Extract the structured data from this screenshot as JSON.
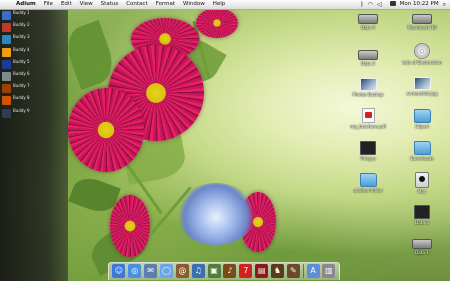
{
  "menubar": {
    "apple_glyph": "",
    "app_name": "Adium",
    "menus": [
      "File",
      "Edit",
      "View",
      "Status",
      "Contact",
      "Format",
      "Window",
      "Help"
    ],
    "clock": "Mon 10:22 PM"
  },
  "buddies": [
    {
      "name": "Buddy 1",
      "status": "",
      "avatar_color": "#3a6ccf"
    },
    {
      "name": "Buddy 2",
      "status": "",
      "avatar_color": "#c0392b"
    },
    {
      "name": "Buddy 3",
      "status": "",
      "avatar_color": "#2e86c1"
    },
    {
      "name": "Buddy 4",
      "status": "",
      "avatar_color": "#f39c12"
    },
    {
      "name": "Buddy 5",
      "status": "",
      "avatar_color": "#1f3a93"
    },
    {
      "name": "Buddy 6",
      "status": "",
      "avatar_color": "#7f8c8d"
    },
    {
      "name": "Buddy 7",
      "status": "",
      "avatar_color": "#a04000"
    },
    {
      "name": "Buddy 8",
      "status": "",
      "avatar_color": "#d35400"
    },
    {
      "name": "Buddy 9",
      "status": "",
      "avatar_color": "#2c3e50"
    }
  ],
  "desktop_icons": {
    "left_column": [
      {
        "label": "Data 4",
        "kind": "hd"
      },
      {
        "label": "Data 2",
        "kind": "hd"
      },
      {
        "label": "Photos Backup",
        "kind": "photo"
      },
      {
        "label": "mp_brochure.pdf",
        "kind": "pdf"
      },
      {
        "label": "Tintype",
        "kind": "bk"
      },
      {
        "label": "untitled folder",
        "kind": "folder"
      }
    ],
    "right_column": [
      {
        "label": "Macintosh HD",
        "kind": "hd"
      },
      {
        "label": "Lots of Destruction",
        "kind": "disc"
      },
      {
        "label": "screenshot.jpg",
        "kind": "photo"
      },
      {
        "label": "Clipart",
        "kind": "folder"
      },
      {
        "label": "Downloads",
        "kind": "folder"
      },
      {
        "label": "Mac",
        "kind": "macpic"
      },
      {
        "label": "Data 3",
        "kind": "bk"
      },
      {
        "label": "Data 1",
        "kind": "hd"
      }
    ]
  },
  "dock_items": [
    {
      "name": "finder",
      "color": "#3c78d8",
      "glyph": "☺"
    },
    {
      "name": "safari",
      "color": "#4a90e2",
      "glyph": "◎"
    },
    {
      "name": "mail",
      "color": "#5a7fb0",
      "glyph": "✉"
    },
    {
      "name": "ichat",
      "color": "#6aa6e8",
      "glyph": "◯"
    },
    {
      "name": "address-book",
      "color": "#8a5a2b",
      "glyph": "@"
    },
    {
      "name": "itunes",
      "color": "#3a6fb0",
      "glyph": "♫"
    },
    {
      "name": "iphoto",
      "color": "#4f7f3a",
      "glyph": "▣"
    },
    {
      "name": "garageband",
      "color": "#7a4a1a",
      "glyph": "♪"
    },
    {
      "name": "ical",
      "color": "#d02020",
      "glyph": "7"
    },
    {
      "name": "dictionary",
      "color": "#8b1a1a",
      "glyph": "▤"
    },
    {
      "name": "chess",
      "color": "#5a3a1a",
      "glyph": "♞"
    },
    {
      "name": "preview",
      "color": "#6a4a2a",
      "glyph": "✎"
    },
    {
      "name": "applications",
      "color": "#5b8fd6",
      "glyph": "A"
    },
    {
      "name": "trash",
      "color": "#8a8a8a",
      "glyph": "▥"
    }
  ]
}
